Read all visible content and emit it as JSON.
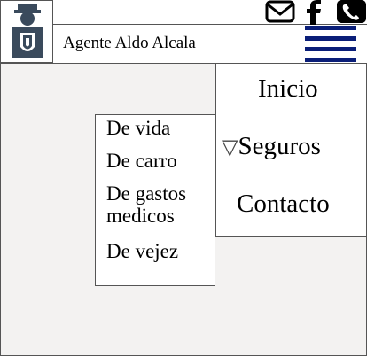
{
  "header": {
    "agent_name": "Agente Aldo Alcala",
    "icons": [
      "agent-logo-icon",
      "mail-icon",
      "facebook-icon",
      "phone-icon",
      "hamburger-menu-icon"
    ],
    "menu_color": "#0a1e78"
  },
  "nav": {
    "items": [
      {
        "label": "Inicio"
      },
      {
        "label": "Seguros",
        "prefix": "▽"
      },
      {
        "label": "Contacto"
      }
    ]
  },
  "submenu": {
    "items": [
      {
        "label": "De vida"
      },
      {
        "label": "De carro"
      },
      {
        "label": "De gastos medicos"
      },
      {
        "label": "De vejez"
      }
    ]
  }
}
